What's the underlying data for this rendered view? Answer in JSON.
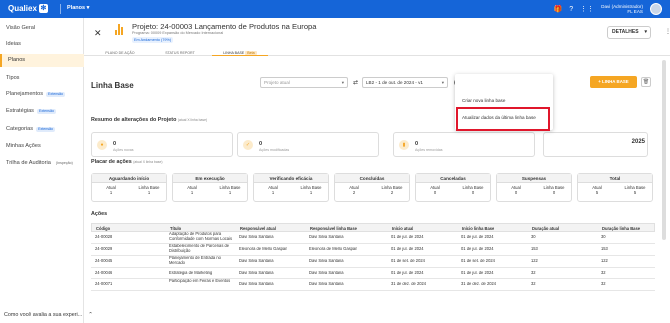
{
  "topbar": {
    "brand": "Qualiex",
    "module": "Planos",
    "user_name": "Davi (Administrador)",
    "user_company": "FL EAS",
    "help": "?"
  },
  "sidebar": {
    "items": [
      {
        "label": "Visão Geral",
        "tag": ""
      },
      {
        "label": "Ideias",
        "tag": ""
      },
      {
        "label": "Planos",
        "tag": ""
      },
      {
        "label": "Tipos",
        "tag": ""
      },
      {
        "label": "Planejamentos",
        "tag": "Extensão"
      },
      {
        "label": "Estratégias",
        "tag": "Extensão"
      },
      {
        "label": "Categorias",
        "tag": "Extensão"
      },
      {
        "label": "Minhas Ações",
        "tag": ""
      },
      {
        "label": "Trilha de Auditoria",
        "tag": "(Inspeção)"
      }
    ],
    "feedback_text": "Como você avalia a sua experi..."
  },
  "project": {
    "title": "Projeto: 24-00003 Lançamento de Produtos na Europa",
    "program": "Programa: 00009 Expansão do Mercado Internacional",
    "status": "Em Andamento (79%)",
    "tabs": [
      "PLANO DE AÇÃO",
      "STATUS REPORT",
      "LINHA BASE"
    ],
    "beta": "Beta",
    "details_label": "DETALHES"
  },
  "linha_base": {
    "title": "Linha Base",
    "project_placeholder": "Projeto atual",
    "baseline_value": "LB2 - 1 de out. de 2024 - v1",
    "new_button": "+ LINHA BASE",
    "menu": [
      "Criar nova linha base",
      "Atualizar dados da última linha base"
    ]
  },
  "summary": {
    "title": "Resumo de alterações do Projeto",
    "subtitle": "(atual X linha base)",
    "cards": [
      {
        "value": "0",
        "label": "Ações novas"
      },
      {
        "value": "0",
        "label": "Ações modificadas"
      },
      {
        "value": "0",
        "label": "Ações removidas"
      }
    ],
    "partial_value": "2025"
  },
  "placar": {
    "title": "Placar de ações",
    "subtitle": "(atual X linha base)",
    "col_labels": [
      "Atual",
      "Linha Base"
    ],
    "groups": [
      {
        "name": "Aguardando início",
        "atual": "1",
        "base": "1"
      },
      {
        "name": "Em execução",
        "atual": "1",
        "base": "1"
      },
      {
        "name": "Verificando eficácia",
        "atual": "1",
        "base": "1"
      },
      {
        "name": "Concluídas",
        "atual": "2",
        "base": "2"
      },
      {
        "name": "Canceladas",
        "atual": "0",
        "base": "0"
      },
      {
        "name": "Suspensas",
        "atual": "0",
        "base": "0"
      },
      {
        "name": "Total",
        "atual": "5",
        "base": "5"
      }
    ]
  },
  "acoes": {
    "title": "Ações",
    "columns": [
      "Código",
      "Título",
      "Responsável atual",
      "Responsável linha Base",
      "Início atual",
      "Início linha Base",
      "Duração atual",
      "Duração linha Base"
    ],
    "rows": [
      [
        "24-00028",
        "Adaptação de Produtos para Conformidade com Normas Locais",
        "Davi Silva Santana",
        "Davi Silva Santana",
        "01 de jul. de 2024",
        "01 de jul. de 2024",
        "30",
        "30"
      ],
      [
        "24-00029",
        "Estabelecimento de Parcerias de Distribuição",
        "Eleonora de Mello Gaspari",
        "Eleonora de Mello Gaspari",
        "01 de jul. de 2024",
        "01 de jul. de 2024",
        "153",
        "153"
      ],
      [
        "24-00045",
        "Planejamento de Entrada no Mercado",
        "Davi Silva Santana",
        "Davi Silva Santana",
        "01 de set. de 2024",
        "01 de set. de 2024",
        "122",
        "122"
      ],
      [
        "24-00046",
        "Estratégia de Marketing",
        "Davi Silva Santana",
        "Davi Silva Santana",
        "01 de jul. de 2024",
        "01 de jul. de 2024",
        "32",
        "32"
      ],
      [
        "24-00071",
        "Participação em Feiras e Eventos",
        "Davi Silva Santana",
        "Davi Silva Santana",
        "31 de dez. de 2024",
        "31 de dez. de 2024",
        "32",
        "32"
      ]
    ]
  }
}
